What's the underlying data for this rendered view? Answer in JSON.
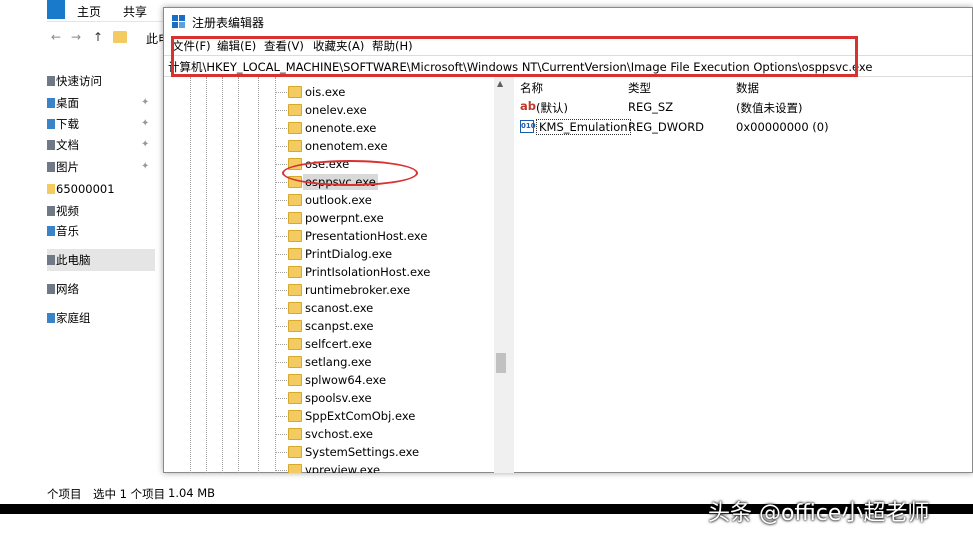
{
  "explorer": {
    "ribbon_tabs": [
      "主页",
      "共享"
    ],
    "address_text": "此电",
    "nav_items": [
      {
        "label": "快速访问",
        "icon": "star-icon",
        "pinned": false
      },
      {
        "label": "桌面",
        "icon": "desktop-icon",
        "pinned": true
      },
      {
        "label": "下载",
        "icon": "download-icon",
        "pinned": true
      },
      {
        "label": "文档",
        "icon": "document-icon",
        "pinned": true
      },
      {
        "label": "图片",
        "icon": "picture-icon",
        "pinned": true
      },
      {
        "label": "65000001",
        "icon": "folder-icon",
        "pinned": false
      },
      {
        "label": "视频",
        "icon": "video-icon",
        "pinned": false
      },
      {
        "label": "音乐",
        "icon": "music-icon",
        "pinned": false
      },
      {
        "label": "此电脑",
        "icon": "computer-icon",
        "pinned": false
      },
      {
        "label": "网络",
        "icon": "network-icon",
        "pinned": false
      },
      {
        "label": "家庭组",
        "icon": "homegroup-icon",
        "pinned": false
      }
    ],
    "status": {
      "items": "个项目",
      "selected": "选中 1 个项目",
      "size": "1.04 MB"
    }
  },
  "regedit": {
    "title": "注册表编辑器",
    "menu": [
      "文件(F)",
      "编辑(E)",
      "查看(V)",
      "收藏夹(A)",
      "帮助(H)"
    ],
    "address": "计算机\\HKEY_LOCAL_MACHINE\\SOFTWARE\\Microsoft\\Windows NT\\CurrentVersion\\Image File Execution Options\\osppsvc.exe",
    "tree_items": [
      "ois.exe",
      "onelev.exe",
      "onenote.exe",
      "onenotem.exe",
      "ose.exe",
      "osppsvc.exe",
      "outlook.exe",
      "powerpnt.exe",
      "PresentationHost.exe",
      "PrintDialog.exe",
      "PrintIsolationHost.exe",
      "runtimebroker.exe",
      "scanost.exe",
      "scanpst.exe",
      "selfcert.exe",
      "setlang.exe",
      "splwow64.exe",
      "spoolsv.exe",
      "SppExtComObj.exe",
      "svchost.exe",
      "SystemSettings.exe",
      "vpreview.exe"
    ],
    "selected_tree_item": "osppsvc.exe",
    "columns": {
      "name": "名称",
      "type": "类型",
      "data": "数据"
    },
    "values": [
      {
        "icon": "string-value-icon",
        "glyph": "ab",
        "name": "(默认)",
        "type": "REG_SZ",
        "data": "(数值未设置)"
      },
      {
        "icon": "dword-value-icon",
        "glyph": "010",
        "name": "KMS_Emulation",
        "type": "REG_DWORD",
        "data": "0x00000000 (0)"
      }
    ]
  },
  "watermark": "头条 @office小超老师",
  "colors": {
    "annotation_red": "#d93030",
    "folder_yellow": "#f4cb62",
    "selection_gray": "#d9d9d9"
  }
}
